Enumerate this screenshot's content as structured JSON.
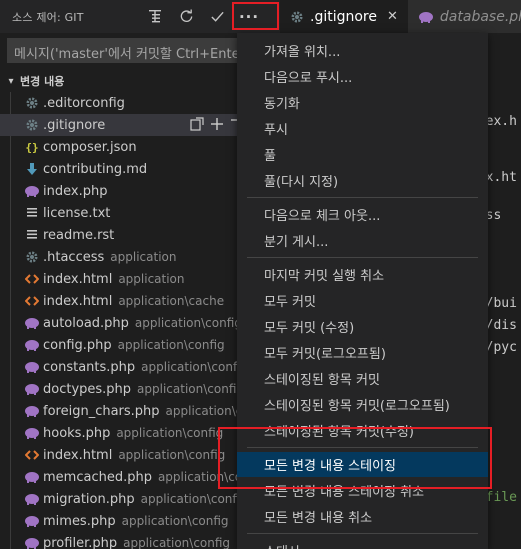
{
  "topbar": {
    "scm_title": "소스 제어: GIT",
    "more_label": "···",
    "tabs": [
      {
        "label": ".gitignore",
        "active": true,
        "close": "✕"
      },
      {
        "label": "database.php",
        "active": false
      }
    ]
  },
  "commit": {
    "placeholder": "메시지('master'에서 커밋할 Ctrl+Enter)"
  },
  "changes": {
    "header": "변경 내용",
    "files": [
      {
        "name": ".editorconfig",
        "path": "",
        "icon": "gear-icon"
      },
      {
        "name": ".gitignore",
        "path": "",
        "icon": "gear-icon",
        "selected": true
      },
      {
        "name": "composer.json",
        "path": "",
        "icon": "braces-icon"
      },
      {
        "name": "contributing.md",
        "path": "",
        "icon": "markdown-arrow-icon"
      },
      {
        "name": "index.php",
        "path": "",
        "icon": "php-elephant-icon"
      },
      {
        "name": "license.txt",
        "path": "",
        "icon": "lines-icon"
      },
      {
        "name": "readme.rst",
        "path": "",
        "icon": "lines-icon"
      },
      {
        "name": ".htaccess",
        "path": "application",
        "icon": "gear-icon"
      },
      {
        "name": "index.html",
        "path": "application",
        "icon": "html-brackets-icon"
      },
      {
        "name": "index.html",
        "path": "application\\cache",
        "icon": "html-brackets-icon"
      },
      {
        "name": "autoload.php",
        "path": "application\\config",
        "icon": "php-elephant-icon"
      },
      {
        "name": "config.php",
        "path": "application\\config",
        "icon": "php-elephant-icon"
      },
      {
        "name": "constants.php",
        "path": "application\\config",
        "icon": "php-elephant-icon"
      },
      {
        "name": "doctypes.php",
        "path": "application\\config",
        "icon": "php-elephant-icon"
      },
      {
        "name": "foreign_chars.php",
        "path": "application\\config",
        "icon": "php-elephant-icon"
      },
      {
        "name": "hooks.php",
        "path": "application\\config",
        "icon": "php-elephant-icon"
      },
      {
        "name": "index.html",
        "path": "application\\config",
        "icon": "html-brackets-icon"
      },
      {
        "name": "memcached.php",
        "path": "application\\config",
        "icon": "php-elephant-icon"
      },
      {
        "name": "migration.php",
        "path": "application\\config",
        "icon": "php-elephant-icon"
      },
      {
        "name": "mimes.php",
        "path": "application\\config",
        "icon": "php-elephant-icon"
      },
      {
        "name": "profiler.php",
        "path": "application\\config",
        "icon": "php-elephant-icon"
      }
    ]
  },
  "menu": {
    "groups": [
      [
        "가져올 위치...",
        "다음으로 푸시...",
        "동기화",
        "푸시",
        "풀",
        "풀(다시 지정)"
      ],
      [
        "다음으로 체크 아웃...",
        "분기 게시..."
      ],
      [
        "마지막 커밋 실행 취소",
        "모두 커밋",
        "모두 커밋 (수정)",
        "모두 커밋(로그오프됨)",
        "스테이징된 항목 커밋",
        "스테이징된 항목 커밋(로그오프됨)",
        "스테이징된 항목 커밋(수정)"
      ],
      [
        "모든 변경 내용 스테이징",
        "모든 변경 내용 스테이징 취소",
        "모든 변경 내용 취소"
      ],
      [
        "스태시"
      ]
    ],
    "highlighted": "모든 변경 내용 스테이징"
  },
  "editor": {
    "lines": [
      {
        "text": "ndex.h",
        "green": false
      },
      {
        "text": "dex.ht",
        "green": false
      },
      {
        "text": "cess",
        "green": false
      },
      {
        "text": "*",
        "green": false
      },
      {
        "text": "er/bui",
        "green": false
      },
      {
        "text": "er/dis",
        "green": false
      },
      {
        "text": "er/pyc",
        "green": false
      },
      {
        "text": "e-file",
        "green": true
      }
    ]
  },
  "colors": {
    "accent_highlight": "#04395e",
    "annotation_red": "#e51e25",
    "php_icon": "#a074c4",
    "html_icon": "#e37933",
    "json_icon": "#cbcb41",
    "md_icon": "#519aba"
  }
}
